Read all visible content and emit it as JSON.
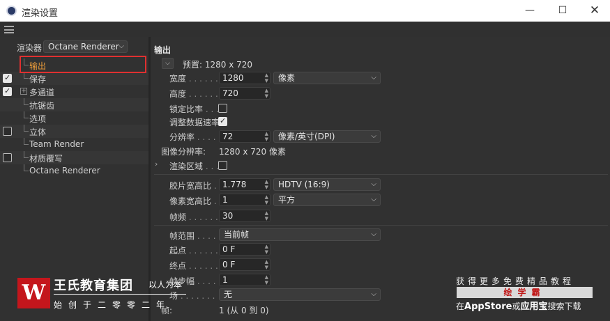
{
  "window": {
    "title": "渲染设置",
    "minimize_glyph": "—",
    "maximize_glyph": "☐",
    "close_glyph": "✕"
  },
  "sidebar": {
    "renderer_label": "渲染器",
    "renderer_value": "Octane Renderer",
    "items": [
      {
        "label": "输出",
        "checked": null,
        "active": true
      },
      {
        "label": "保存",
        "checked": true,
        "active": false
      },
      {
        "label": "多通道",
        "checked": true,
        "active": false,
        "expandable": true
      },
      {
        "label": "抗锯齿",
        "checked": null,
        "active": false
      },
      {
        "label": "选项",
        "checked": null,
        "active": false
      },
      {
        "label": "立体",
        "checked": false,
        "active": false
      },
      {
        "label": "Team Render",
        "checked": null,
        "active": false
      },
      {
        "label": "材质覆写",
        "checked": false,
        "active": false
      },
      {
        "label": "Octane Renderer",
        "checked": null,
        "active": false
      }
    ],
    "expander_glyph": "+"
  },
  "output": {
    "section_title": "输出",
    "preset_label": "预置: 1280 x 720",
    "width": {
      "label": "宽度",
      "dots": " . . . . . .",
      "value": "1280",
      "unit": "像素"
    },
    "height": {
      "label": "高度",
      "dots": " . . . . . .",
      "value": "720"
    },
    "lock_ratio": {
      "label": "锁定比率",
      "dots": " . . .",
      "checked": false
    },
    "adjust_data_rate": {
      "label": "调整数据速率",
      "checked": true
    },
    "resolution": {
      "label": "分辨率",
      "dots": " . . . .",
      "value": "72",
      "unit": "像素/英寸(DPI)"
    },
    "image_resolution": {
      "label": "图像分辨率:",
      "value": "1280 x 720 像素"
    },
    "render_region": {
      "label": "渲染区域",
      "dots": " . . .",
      "checked": false
    },
    "film_aspect": {
      "label": "胶片宽高比",
      "dots": " .",
      "value": "1.778",
      "preset": "HDTV (16:9)"
    },
    "pixel_aspect": {
      "label": "像素宽高比",
      "dots": " .",
      "value": "1",
      "preset": "平方"
    },
    "frame_rate": {
      "label": "帧频",
      "dots": " . . . . . .",
      "value": "30"
    },
    "frame_range": {
      "label": "帧范围",
      "dots": " . . . .",
      "value": "当前帧"
    },
    "start": {
      "label": "起点",
      "dots": " . . . . . .",
      "value": "0 F"
    },
    "end": {
      "label": "终点",
      "dots": " . . . . . .",
      "value": "0 F"
    },
    "frame_step": {
      "label": "帧步幅",
      "dots": " . . . .",
      "value": "1"
    },
    "fields": {
      "label": "场",
      "dots": " . . . . . . .",
      "value": "无"
    },
    "frames": {
      "label": "帧:",
      "value": "1 (从 0 到 0)"
    }
  },
  "watermark_left": {
    "logo": "W",
    "name": "王氏教育集团",
    "slogan": "以人为本",
    "since": "始创于二零零二年"
  },
  "watermark_right": {
    "top": "获得更多免费精品教程",
    "banner": "绘学霸",
    "bottom_prefix": "在",
    "bottom_store": "AppStore",
    "bottom_or": "或",
    "bottom_app": "应用宝",
    "bottom_suffix": "搜索下载"
  },
  "colors": {
    "active_item": "#f2a03a",
    "highlight_box": "#e03030",
    "panel_bg": "#313131",
    "watermark_red": "#c4161c"
  }
}
